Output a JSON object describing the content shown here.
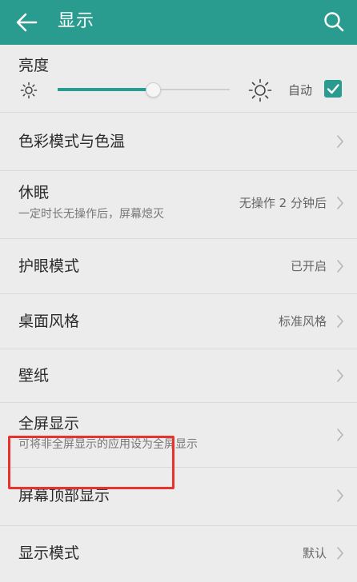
{
  "app_bar": {
    "title": "显示",
    "back_icon": "arrow-left-icon",
    "search_icon": "search-icon",
    "color": "#2a9c8f"
  },
  "brightness": {
    "label": "亮度",
    "level_percent": 55,
    "auto_label": "自动",
    "auto_checked": true
  },
  "settings": [
    {
      "id": "color-mode",
      "title": "色彩模式与色温",
      "subtitle": "",
      "value": ""
    },
    {
      "id": "sleep",
      "title": "休眠",
      "subtitle": "一定时长无操作后，屏幕熄灭",
      "value": "无操作 2 分钟后"
    },
    {
      "id": "eye-comfort",
      "title": "护眼模式",
      "subtitle": "",
      "value": "已开启"
    },
    {
      "id": "desktop-style",
      "title": "桌面风格",
      "subtitle": "",
      "value": "标准风格"
    },
    {
      "id": "wallpaper",
      "title": "壁纸",
      "subtitle": "",
      "value": ""
    },
    {
      "id": "full-screen",
      "title": "全屏显示",
      "subtitle": "可将非全屏显示的应用设为全屏显示",
      "value": ""
    },
    {
      "id": "screen-top-display",
      "title": "屏幕顶部显示",
      "subtitle": "",
      "value": ""
    },
    {
      "id": "display-mode",
      "title": "显示模式",
      "subtitle": "",
      "value": "默认"
    }
  ],
  "highlight_color": "#e8322c"
}
